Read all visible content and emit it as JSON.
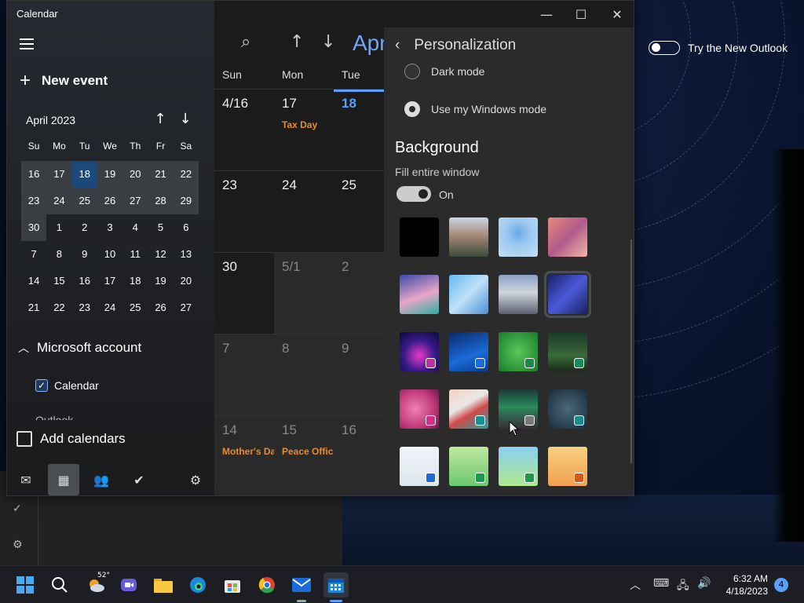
{
  "app": {
    "title": "Calendar"
  },
  "sidebar": {
    "new_event": "New event",
    "mini_month": "April 2023",
    "dow": [
      "Su",
      "Mo",
      "Tu",
      "We",
      "Th",
      "Fr",
      "Sa"
    ],
    "weeks": [
      [
        "16",
        "17",
        "18",
        "19",
        "20",
        "21",
        "22"
      ],
      [
        "23",
        "24",
        "25",
        "26",
        "27",
        "28",
        "29"
      ],
      [
        "30",
        "1",
        "2",
        "3",
        "4",
        "5",
        "6"
      ],
      [
        "7",
        "8",
        "9",
        "10",
        "11",
        "12",
        "13"
      ],
      [
        "14",
        "15",
        "16",
        "17",
        "18",
        "19",
        "20"
      ],
      [
        "21",
        "22",
        "23",
        "24",
        "25",
        "26",
        "27"
      ]
    ],
    "account": "Microsoft account",
    "calendar_label": "Calendar",
    "outlook_peek": "Outlook",
    "add_calendars": "Add calendars"
  },
  "main": {
    "month_label": "Apr",
    "dow": [
      "Sun",
      "Mon",
      "Tue"
    ],
    "weeks": [
      [
        {
          "n": "4/16"
        },
        {
          "n": "17",
          "ev": "Tax Day"
        },
        {
          "n": "18",
          "today": true
        }
      ],
      [
        {
          "n": "23"
        },
        {
          "n": "24"
        },
        {
          "n": "25"
        }
      ],
      [
        {
          "n": "30"
        },
        {
          "n": "5/1",
          "dim": true
        },
        {
          "n": "2",
          "dim": true
        }
      ],
      [
        {
          "n": "7",
          "dim": true
        },
        {
          "n": "8",
          "dim": true
        },
        {
          "n": "9",
          "dim": true
        }
      ],
      [
        {
          "n": "14",
          "dim": true,
          "ev": "Mother's Day"
        },
        {
          "n": "15",
          "dim": true,
          "ev": "Peace Officers"
        },
        {
          "n": "16",
          "dim": true
        }
      ]
    ]
  },
  "panel": {
    "title": "Personalization",
    "dark_mode": "Dark mode",
    "windows_mode": "Use my Windows mode",
    "background": "Background",
    "fill_window": "Fill entire window",
    "toggle_state": "On"
  },
  "try_outlook": "Try the New Outlook",
  "taskbar": {
    "weather_temp": "52°",
    "time": "6:32 AM",
    "date": "4/18/2023",
    "notifications": "4"
  },
  "swatches": [
    {
      "bg": "#000000"
    },
    {
      "bg": "linear-gradient(180deg,#c9d6e6 0%,#a88a7a 45%,#3c4a3a 100%)"
    },
    {
      "bg": "radial-gradient(circle at 50% 40%,#6aa8e8 0%,#9cc8f0 40%,#c6dff2 100%)"
    },
    {
      "bg": "linear-gradient(135deg,#e88a7a 0%,#b05a8a 50%,#f2b6a6 100%)"
    },
    {
      "bg": "linear-gradient(160deg,#3a4aa8 0%,#e8a6c8 55%,#2ab0a0 100%)"
    },
    {
      "bg": "linear-gradient(135deg,#6ab8f0 0%,#bfe0f8 50%,#4a90d8 100%)"
    },
    {
      "bg": "linear-gradient(180deg,#8aa0c8 0%,#d0d6dc 45%,#5a6070 100%)"
    },
    {
      "bg": "linear-gradient(135deg,#1a1f6a 0%,#4a5ad8 50%,#1a2060 100%)",
      "sel": true
    },
    {
      "bg": "radial-gradient(circle at 50% 60%,#e83ac8 0%,#3a1a8a 50%,#0a0a3a 100%)",
      "badge": "#c030a0"
    },
    {
      "bg": "linear-gradient(160deg,#0a2a6a 0%,#1a6ad8 60%,#0a3a8a 100%)",
      "badge": "#1a6ad8"
    },
    {
      "bg": "radial-gradient(circle at 50% 50%,#5ac85a 0%,#1a7a2a 100%)",
      "badge": "#1a8a4a"
    },
    {
      "bg": "linear-gradient(180deg,#1a3a2a 0%,#3a6a3a 60%,#1a2a1a 100%)",
      "badge": "#1a8a5a"
    },
    {
      "bg": "radial-gradient(circle at 40% 50%,#f080b0 0%,#c03a7a 60%,#6a1a4a 100%)",
      "badge": "#d0308a"
    },
    {
      "bg": "linear-gradient(150deg,#f8d0c0 0%,#e8e8e8 40%,#d04a4a 60%,#2aa0a0 100%)",
      "badge": "#1a9090"
    },
    {
      "bg": "linear-gradient(180deg,#1a3a3a 0%,#2a8a5a 45%,#3a2a3a 100%)",
      "badge": "#7a7a7a"
    },
    {
      "bg": "radial-gradient(circle at 50% 50%,#4a6a7a 0%,#1a2a3a 100%)",
      "badge": "#1a8a8a"
    },
    {
      "bg": "linear-gradient(180deg,#f0f4f8 0%,#dde6ee 100%)",
      "badge": "#1a6ad8"
    },
    {
      "bg": "linear-gradient(180deg,#c0e8a0 0%,#6ac870 100%)",
      "badge": "#1a9a4a"
    },
    {
      "bg": "linear-gradient(180deg,#8ad0f0 0%,#b0e890 100%)",
      "badge": "#1a9a4a"
    },
    {
      "bg": "linear-gradient(180deg,#f8d080 0%,#f0a050 100%)",
      "badge": "#d05a1a"
    }
  ]
}
